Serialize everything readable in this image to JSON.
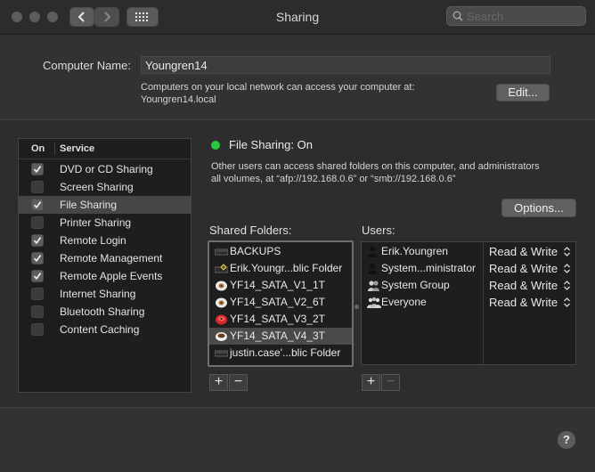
{
  "window": {
    "title": "Sharing",
    "search_placeholder": "Search"
  },
  "computer_name": {
    "label": "Computer Name:",
    "value": "Youngren14",
    "description_line1": "Computers on your local network can access your computer at:",
    "description_line2": "Youngren14.local",
    "edit_button": "Edit..."
  },
  "services": {
    "header_on": "On",
    "header_service": "Service",
    "items": [
      {
        "label": "DVD or CD Sharing",
        "checked": true
      },
      {
        "label": "Screen Sharing",
        "checked": false
      },
      {
        "label": "File Sharing",
        "checked": true,
        "selected": true
      },
      {
        "label": "Printer Sharing",
        "checked": false
      },
      {
        "label": "Remote Login",
        "checked": true
      },
      {
        "label": "Remote Management",
        "checked": true
      },
      {
        "label": "Remote Apple Events",
        "checked": true
      },
      {
        "label": "Internet Sharing",
        "checked": false
      },
      {
        "label": "Bluetooth Sharing",
        "checked": false
      },
      {
        "label": "Content Caching",
        "checked": false
      }
    ]
  },
  "file_sharing": {
    "status": "File Sharing: On",
    "status_color": "#28c840",
    "description_line1": "Other users can access shared folders on this computer, and administrators",
    "description_line2": "all volumes, at “afp://192.168.0.6” or “smb://192.168.0.6”",
    "options_button": "Options..."
  },
  "shared_folders": {
    "label": "Shared Folders:",
    "items": [
      {
        "name": "BACKUPS",
        "icon": "drive-icon"
      },
      {
        "name": "Erik.Youngr...blic Folder",
        "icon": "public-folder-icon"
      },
      {
        "name": "YF14_SATA_V1_1T",
        "icon": "hd-icon"
      },
      {
        "name": "YF14_SATA_V2_6T",
        "icon": "hd-icon"
      },
      {
        "name": "YF14_SATA_V3_2T",
        "icon": "red-hd-icon"
      },
      {
        "name": "YF14_SATA_V4_3T",
        "icon": "coffee-icon",
        "selected": true
      },
      {
        "name": "justin.case'...blic Folder",
        "icon": "drive-icon"
      }
    ],
    "add": "+",
    "remove": "−"
  },
  "users": {
    "label": "Users:",
    "items": [
      {
        "name": "Erik.Youngren",
        "permission": "Read & Write",
        "icon": "user-icon"
      },
      {
        "name": "System...ministrator",
        "permission": "Read & Write",
        "icon": "user-icon"
      },
      {
        "name": "System Group",
        "permission": "Read & Write",
        "icon": "group-icon"
      },
      {
        "name": "Everyone",
        "permission": "Read & Write",
        "icon": "everyone-icon"
      }
    ],
    "add": "+",
    "remove": "−"
  },
  "help": "?"
}
